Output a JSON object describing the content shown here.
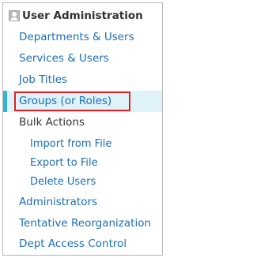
{
  "header": {
    "title": "User Administration",
    "icon": "user-icon"
  },
  "nav": {
    "departments_users": "Departments & Users",
    "services_users": "Services & Users",
    "job_titles": "Job Titles",
    "groups_roles": "Groups (or Roles)",
    "bulk_actions": "Bulk Actions",
    "import_from_file": "Import from File",
    "export_to_file": "Export to File",
    "delete_users": "Delete Users",
    "administrators": "Administrators",
    "tentative_reorganization": "Tentative Reorganization",
    "dept_access_control": "Dept Access Control"
  },
  "colors": {
    "link": "#1a6fb5",
    "active_bg": "#dff2f8",
    "active_bar": "#33b3d6",
    "highlight": "#e02020"
  }
}
